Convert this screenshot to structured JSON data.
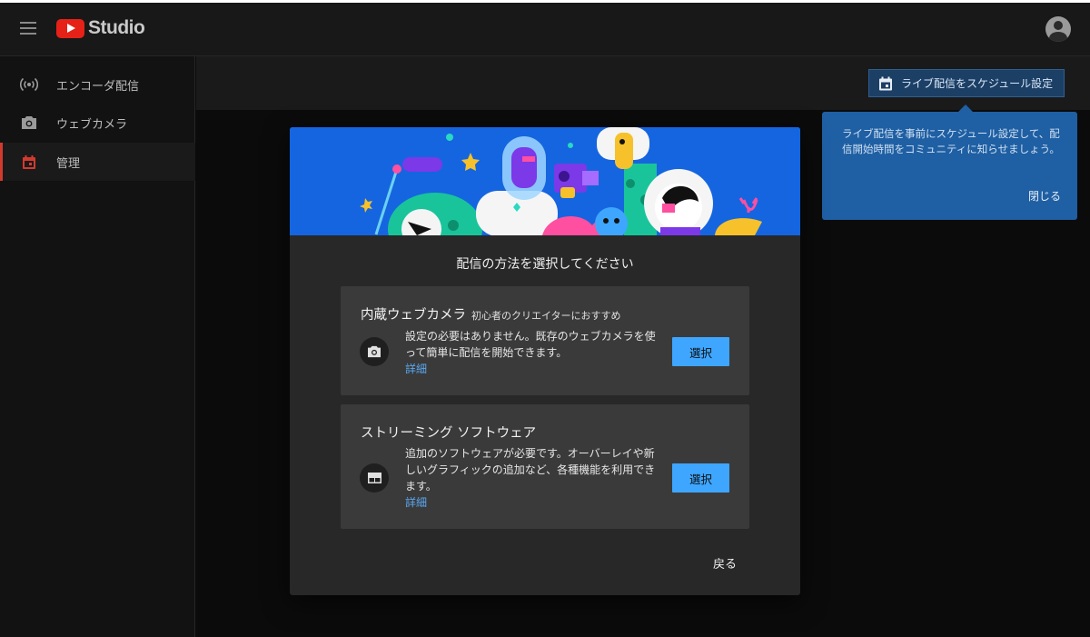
{
  "app": {
    "logo_text": "Studio"
  },
  "sidebar": {
    "items": [
      {
        "label": "エンコーダ配信",
        "icon": "broadcast-icon"
      },
      {
        "label": "ウェブカメラ",
        "icon": "camera-icon"
      },
      {
        "label": "管理",
        "icon": "calendar-icon",
        "active": true
      }
    ]
  },
  "header": {
    "schedule_button": "ライブ配信をスケジュール設定"
  },
  "tooltip": {
    "text": "ライブ配信を事前にスケジュール設定して、配信開始時間をコミュニティに知らせましょう。",
    "close": "閉じる"
  },
  "dialog": {
    "title": "配信の方法を選択してください",
    "options": [
      {
        "title": "内蔵ウェブカメラ",
        "subtitle": "初心者のクリエイターにおすすめ",
        "description": "設定の必要はありません。既存のウェブカメラを使って簡単に配信を開始できます。",
        "link": "詳細",
        "button": "選択",
        "icon": "camera-icon"
      },
      {
        "title": "ストリーミング ソフトウェア",
        "subtitle": "",
        "description": "追加のソフトウェアが必要です。オーバーレイや新しいグラフィックの追加など、各種機能を利用できます。",
        "link": "詳細",
        "button": "選択",
        "icon": "layout-icon"
      }
    ],
    "back": "戻る"
  },
  "colors": {
    "accent": "#3ea6ff",
    "brand_red": "#e62117",
    "banner_blue": "#1565e0",
    "tooltip_blue": "#1f5fa3"
  }
}
